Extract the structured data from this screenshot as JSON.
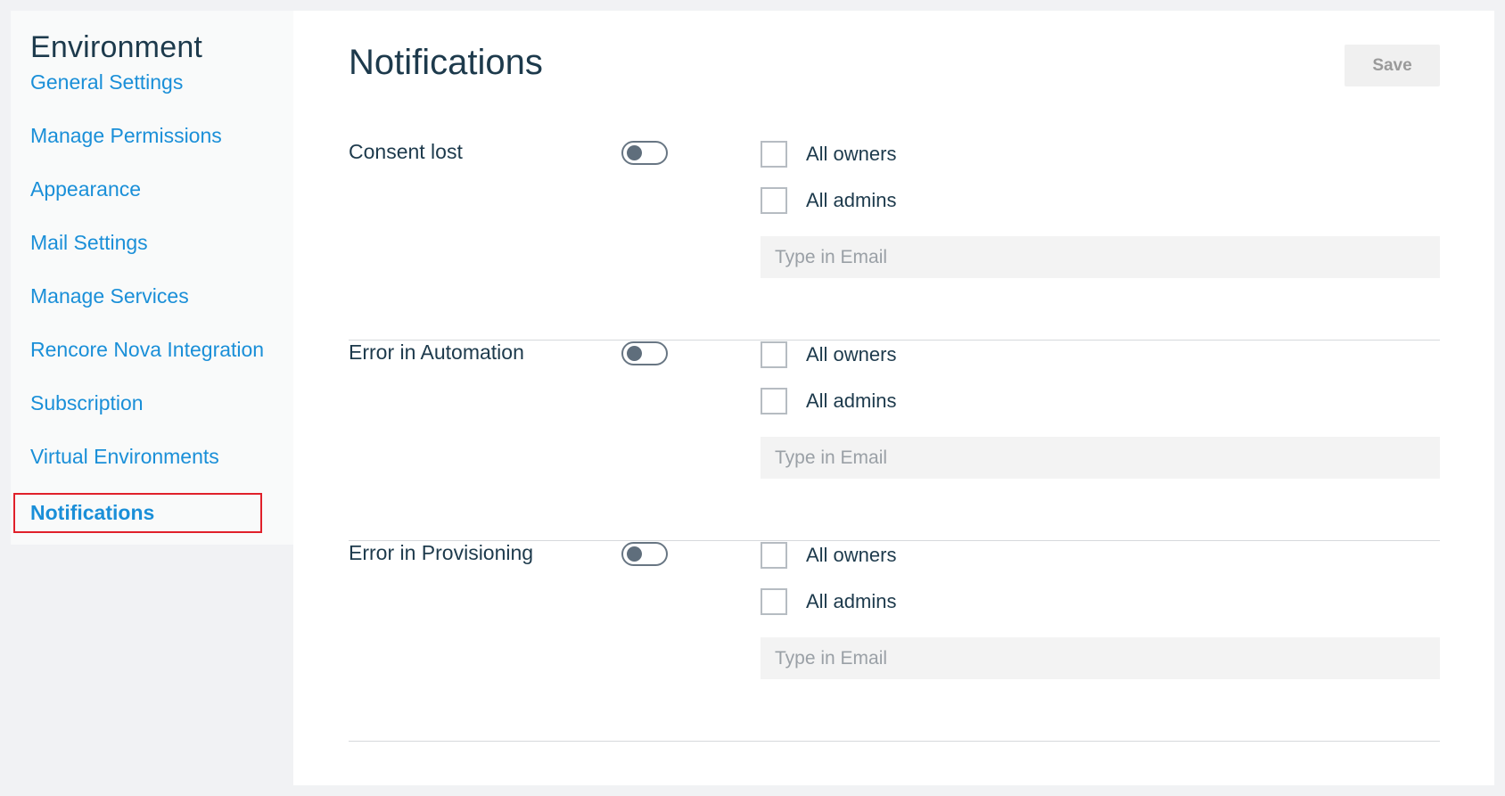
{
  "sidebar": {
    "title": "Environment",
    "items": [
      {
        "label": "General Settings"
      },
      {
        "label": "Manage Permissions"
      },
      {
        "label": "Appearance"
      },
      {
        "label": "Mail Settings"
      },
      {
        "label": "Manage Services"
      },
      {
        "label": "Rencore Nova Integration"
      },
      {
        "label": "Subscription"
      },
      {
        "label": "Virtual Environments"
      },
      {
        "label": "Notifications",
        "active": true
      }
    ]
  },
  "main": {
    "title": "Notifications",
    "save_label": "Save",
    "sections": [
      {
        "label": "Consent lost",
        "toggle_on": false,
        "owners_label": "All owners",
        "admins_label": "All admins",
        "email_placeholder": "Type in Email"
      },
      {
        "label": "Error in Automation",
        "toggle_on": false,
        "owners_label": "All owners",
        "admins_label": "All admins",
        "email_placeholder": "Type in Email"
      },
      {
        "label": "Error in Provisioning",
        "toggle_on": false,
        "owners_label": "All owners",
        "admins_label": "All admins",
        "email_placeholder": "Type in Email"
      }
    ]
  },
  "colors": {
    "accent": "#1a8fd8",
    "heading": "#1d3a4c",
    "highlight_border": "#e0202a"
  }
}
